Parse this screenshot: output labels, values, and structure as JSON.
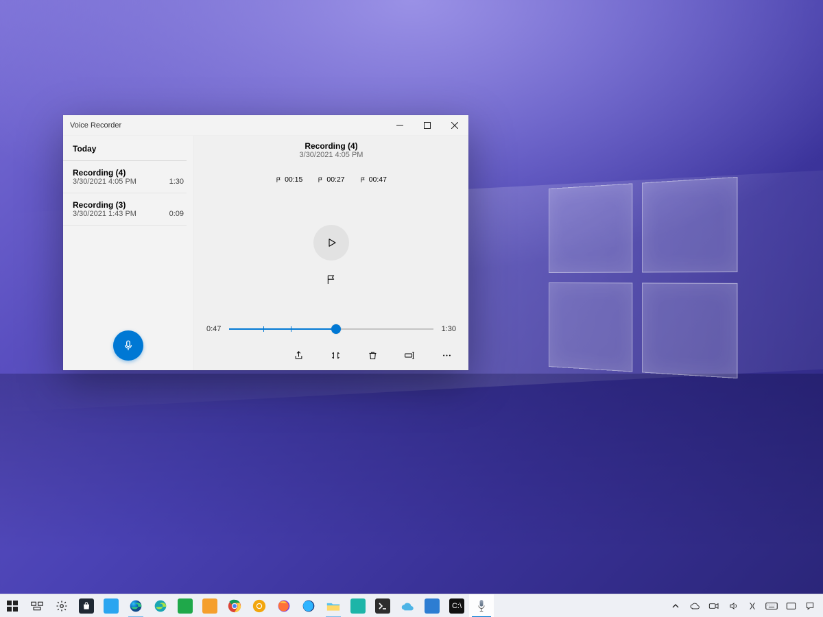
{
  "window": {
    "title": "Voice Recorder",
    "sidebar": {
      "group_label": "Today",
      "items": [
        {
          "name": "Recording (4)",
          "date": "3/30/2021 4:05 PM",
          "duration": "1:30"
        },
        {
          "name": "Recording (3)",
          "date": "3/30/2021 1:43 PM",
          "duration": "0:09"
        }
      ]
    },
    "detail": {
      "title": "Recording (4)",
      "subtitle": "3/30/2021 4:05 PM",
      "markers": [
        "00:15",
        "00:27",
        "00:47"
      ],
      "position_label": "0:47",
      "duration_label": "1:30",
      "position_seconds": 47,
      "duration_seconds": 90,
      "marker_seconds": [
        15,
        27,
        47
      ]
    }
  },
  "taskbar": {
    "apps": [
      {
        "name": "start",
        "type": "winstart"
      },
      {
        "name": "task-view",
        "type": "taskview"
      },
      {
        "name": "settings",
        "type": "gear"
      },
      {
        "name": "microsoft-store",
        "type": "store"
      },
      {
        "name": "app-blue",
        "type": "square",
        "color": "#2aa5f0"
      },
      {
        "name": "edge",
        "type": "edge",
        "running": true
      },
      {
        "name": "edge-dev",
        "type": "edge2"
      },
      {
        "name": "app-green-badge",
        "type": "square",
        "color": "#1fa84a"
      },
      {
        "name": "app-orange",
        "type": "square",
        "color": "#f59f2c"
      },
      {
        "name": "chrome",
        "type": "chrome"
      },
      {
        "name": "chrome-canary",
        "type": "chrome-canary"
      },
      {
        "name": "firefox",
        "type": "firefox"
      },
      {
        "name": "firefox-dev",
        "type": "firefox-dev"
      },
      {
        "name": "file-explorer",
        "type": "explorer",
        "running": true
      },
      {
        "name": "app-teal",
        "type": "square",
        "color": "#1db5a8"
      },
      {
        "name": "terminal",
        "type": "terminal"
      },
      {
        "name": "app-cloud",
        "type": "cloud"
      },
      {
        "name": "photos",
        "type": "square",
        "color": "#2d7dd2"
      },
      {
        "name": "command-prompt",
        "type": "cmd"
      },
      {
        "name": "voice-recorder",
        "type": "mic",
        "active": true
      }
    ]
  }
}
